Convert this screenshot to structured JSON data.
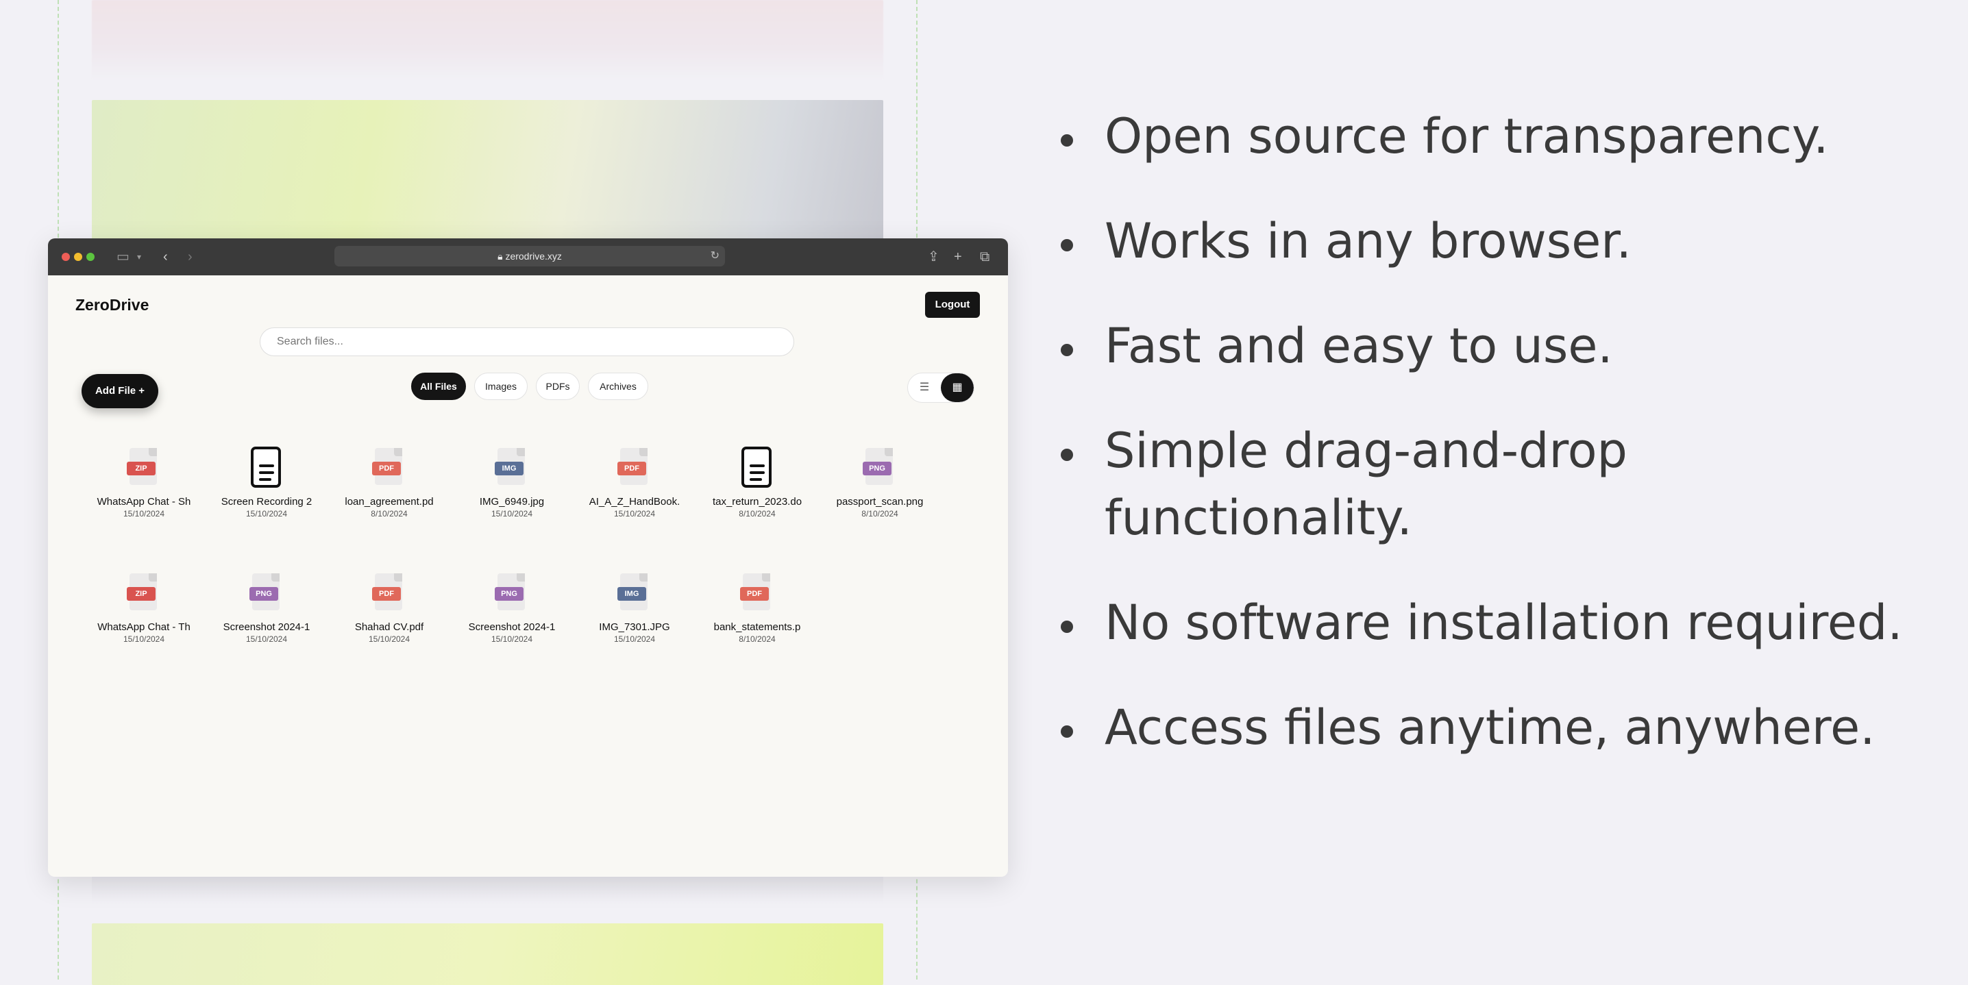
{
  "browser": {
    "url": "zerodrive.xyz"
  },
  "app": {
    "brand": "ZeroDrive",
    "logout_label": "Logout",
    "search_placeholder": "Search files...",
    "add_file_label": "Add File +",
    "filters": [
      "All Files",
      "Images",
      "PDFs",
      "Archives"
    ],
    "active_filter": "All Files",
    "view_mode": "grid",
    "files": [
      {
        "name": "WhatsApp Chat - Sh",
        "date": "15/10/2024",
        "type": "ZIP",
        "color": "#d9534f"
      },
      {
        "name": "Screen Recording 2",
        "date": "15/10/2024",
        "type": "DOC",
        "color": "#111111"
      },
      {
        "name": "loan_agreement.pd",
        "date": "8/10/2024",
        "type": "PDF",
        "color": "#e0685a"
      },
      {
        "name": "IMG_6949.jpg",
        "date": "15/10/2024",
        "type": "IMG",
        "color": "#5a6f96"
      },
      {
        "name": "AI_A_Z_HandBook.",
        "date": "15/10/2024",
        "type": "PDF",
        "color": "#e0685a"
      },
      {
        "name": "tax_return_2023.do",
        "date": "8/10/2024",
        "type": "DOC",
        "color": "#111111"
      },
      {
        "name": "passport_scan.png",
        "date": "8/10/2024",
        "type": "PNG",
        "color": "#9b6bb0"
      },
      {
        "name": "WhatsApp Chat - Th",
        "date": "15/10/2024",
        "type": "ZIP",
        "color": "#d9534f"
      },
      {
        "name": "Screenshot 2024-1",
        "date": "15/10/2024",
        "type": "PNG",
        "color": "#9b6bb0"
      },
      {
        "name": "Shahad CV.pdf",
        "date": "15/10/2024",
        "type": "PDF",
        "color": "#e0685a"
      },
      {
        "name": "Screenshot 2024-1",
        "date": "15/10/2024",
        "type": "PNG",
        "color": "#9b6bb0"
      },
      {
        "name": "IMG_7301.JPG",
        "date": "15/10/2024",
        "type": "IMG",
        "color": "#5a6f96"
      },
      {
        "name": "bank_statements.p",
        "date": "8/10/2024",
        "type": "PDF",
        "color": "#e0685a"
      }
    ]
  },
  "features": [
    "Open source for transparency.",
    "Works in any browser.",
    "Fast and easy to use.",
    "Simple drag-and-drop functionality.",
    "No software installation required.",
    "Access files anytime, anywhere."
  ]
}
